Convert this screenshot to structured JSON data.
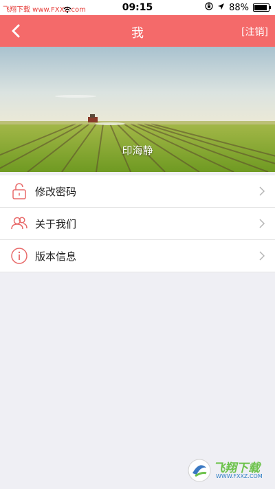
{
  "status_bar": {
    "carrier": "飞翔下载 www.FXXZ.com",
    "time": "09:15",
    "battery": "88%",
    "battery_level": 0.88
  },
  "nav": {
    "title": "我",
    "logout_label": "[注销]"
  },
  "profile": {
    "name": "印海静"
  },
  "menu": {
    "items": [
      {
        "label": "修改密码",
        "icon": "lock-icon"
      },
      {
        "label": "关于我们",
        "icon": "users-icon"
      },
      {
        "label": "版本信息",
        "icon": "info-icon"
      }
    ]
  },
  "watermark": {
    "title": "飞翔下载",
    "url": "WWW.FXXZ.COM"
  },
  "colors": {
    "accent": "#f46a6a",
    "background": "#efeff4"
  }
}
